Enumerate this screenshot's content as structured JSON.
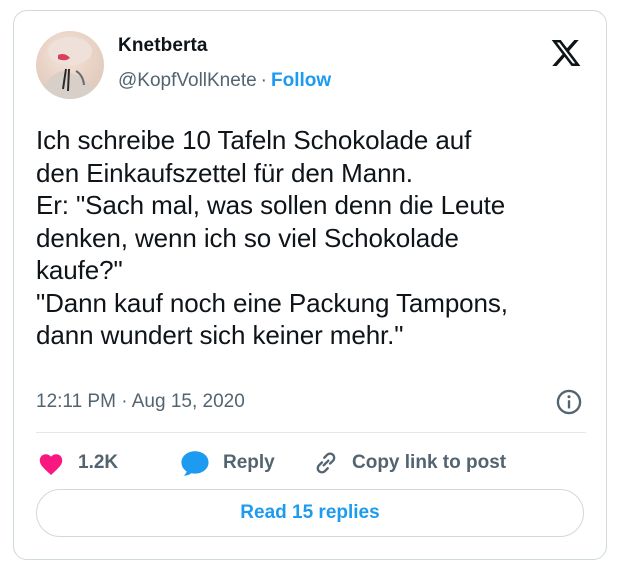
{
  "author": {
    "display_name": "Knetberta",
    "handle": "@KopfVollKnete",
    "separator": "·",
    "follow_label": "Follow"
  },
  "tweet": {
    "lines": [
      "Ich schreibe 10 Tafeln Schokolade auf",
      "den Einkaufszettel für den Mann.",
      "Er: \"Sach mal, was sollen denn die Leute",
      "denken, wenn ich so viel Schokolade",
      "kaufe?\"",
      "\"Dann kauf noch eine Packung Tampons,",
      "dann wundert sich keiner mehr.\""
    ],
    "timestamp": "12:11 PM · Aug 15, 2020"
  },
  "actions": {
    "like_count": "1.2K",
    "reply_label": "Reply",
    "copy_link_label": "Copy link to post"
  },
  "read_replies_label": "Read 15 replies",
  "icons": {
    "brand": "x-logo-icon",
    "info": "info-icon",
    "like": "heart-icon",
    "reply": "speech-bubble-icon",
    "copy_link": "link-icon"
  },
  "colors": {
    "accent": "#1d9bf0",
    "like": "#f91880",
    "text": "#0f1419",
    "muted": "#536471",
    "border": "#cfd9de"
  }
}
